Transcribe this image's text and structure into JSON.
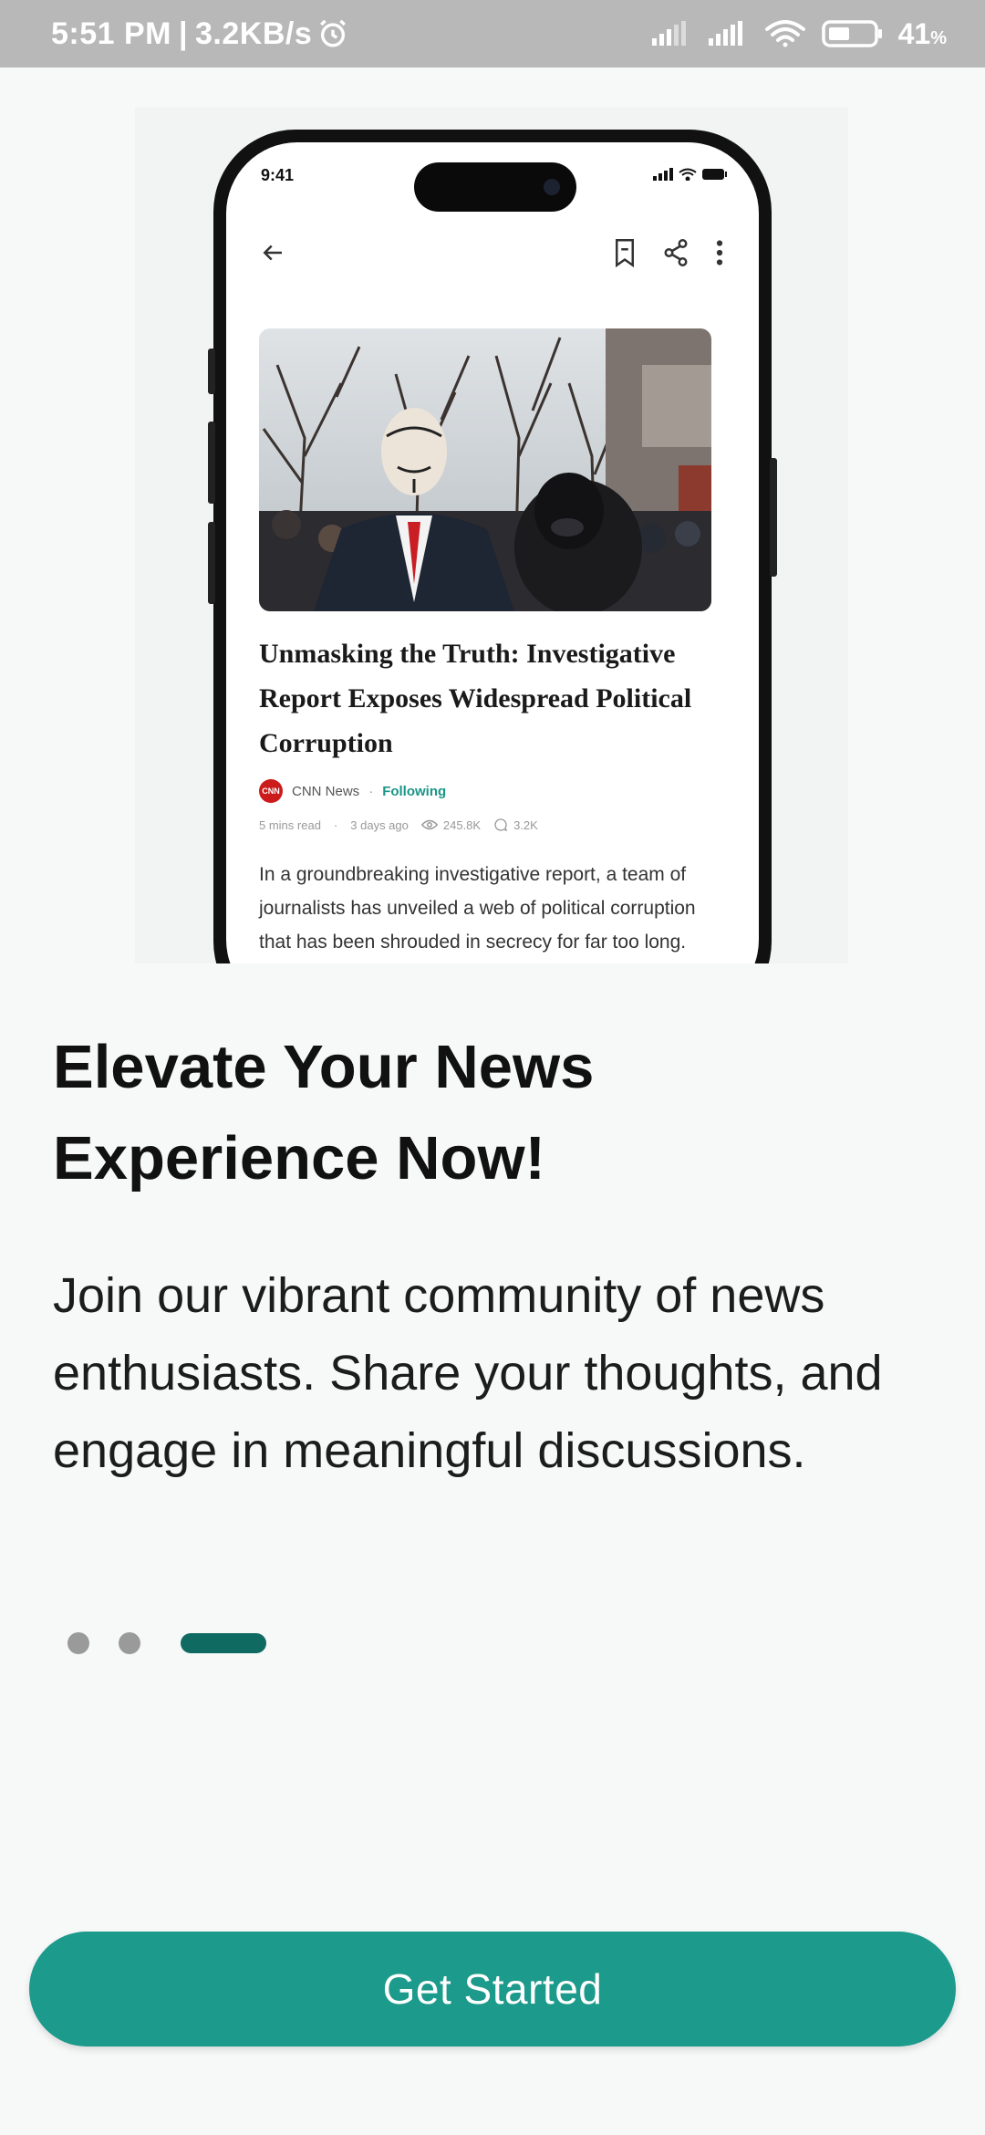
{
  "status_bar": {
    "time": "5:51 PM",
    "separator": "|",
    "net_speed": "3.2KB/s",
    "battery_level": "41",
    "battery_unit": "%"
  },
  "mockup": {
    "device_time": "9:41",
    "article": {
      "title": "Unmasking the Truth: Investigative Report Exposes Widespread Political Corruption",
      "source_name": "CNN News",
      "source_logo_text": "CNN",
      "follow_status": "Following",
      "read_time": "5 mins read",
      "posted": "3 days ago",
      "views": "245.8K",
      "comments": "3.2K",
      "body": "In a groundbreaking investigative report, a team of journalists has unveiled a web of political corruption that has been shrouded in secrecy for far too long. This in-depth exposé"
    }
  },
  "onboarding": {
    "headline": "Elevate Your News Experience Now!",
    "description": "Join our vibrant community of news enthusiasts. Share your thoughts, and engage in meaningful discussions.",
    "page_count": 3,
    "current_page": 3,
    "cta_label": "Get Started"
  },
  "colors": {
    "accent": "#1c9a8b",
    "pager_active": "#0f6b62",
    "pager_inactive": "#9a9a9a",
    "status_bar_bg": "#b8b8b8",
    "following": "#1a9688",
    "cnn_red": "#cc1b1b"
  }
}
